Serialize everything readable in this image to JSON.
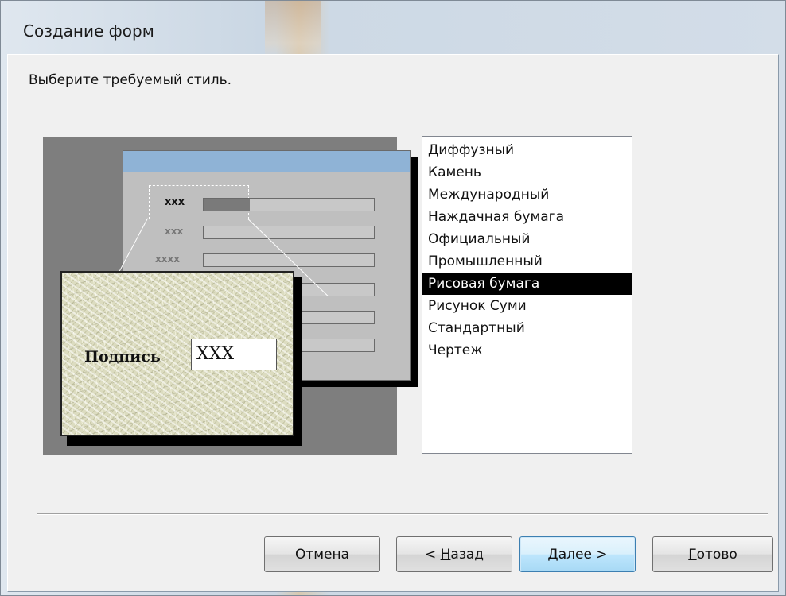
{
  "window": {
    "title": "Создание форм"
  },
  "prompt": "Выберите требуемый стиль.",
  "preview": {
    "rows": [
      {
        "label": "xxx",
        "active": true
      },
      {
        "label": "xxx",
        "active": false
      },
      {
        "label": "xxxx",
        "active": false
      }
    ],
    "card_label": "Подпись",
    "card_value": "XXX"
  },
  "styles_list": {
    "items": [
      "Диффузный",
      "Камень",
      "Международный",
      "Наждачная бумага",
      "Официальный",
      "Промышленный",
      "Рисовая бумага",
      "Рисунок Суми",
      "Стандартный",
      "Чертеж"
    ],
    "selected": "Рисовая бумага"
  },
  "buttons": {
    "cancel": "Отмена",
    "back_prefix": "< ",
    "back_hotkey": "Н",
    "back_rest": "азад",
    "next_hotkey": "Д",
    "next_rest": "алее >",
    "finish_hotkey": "Г",
    "finish_rest": "отово"
  }
}
